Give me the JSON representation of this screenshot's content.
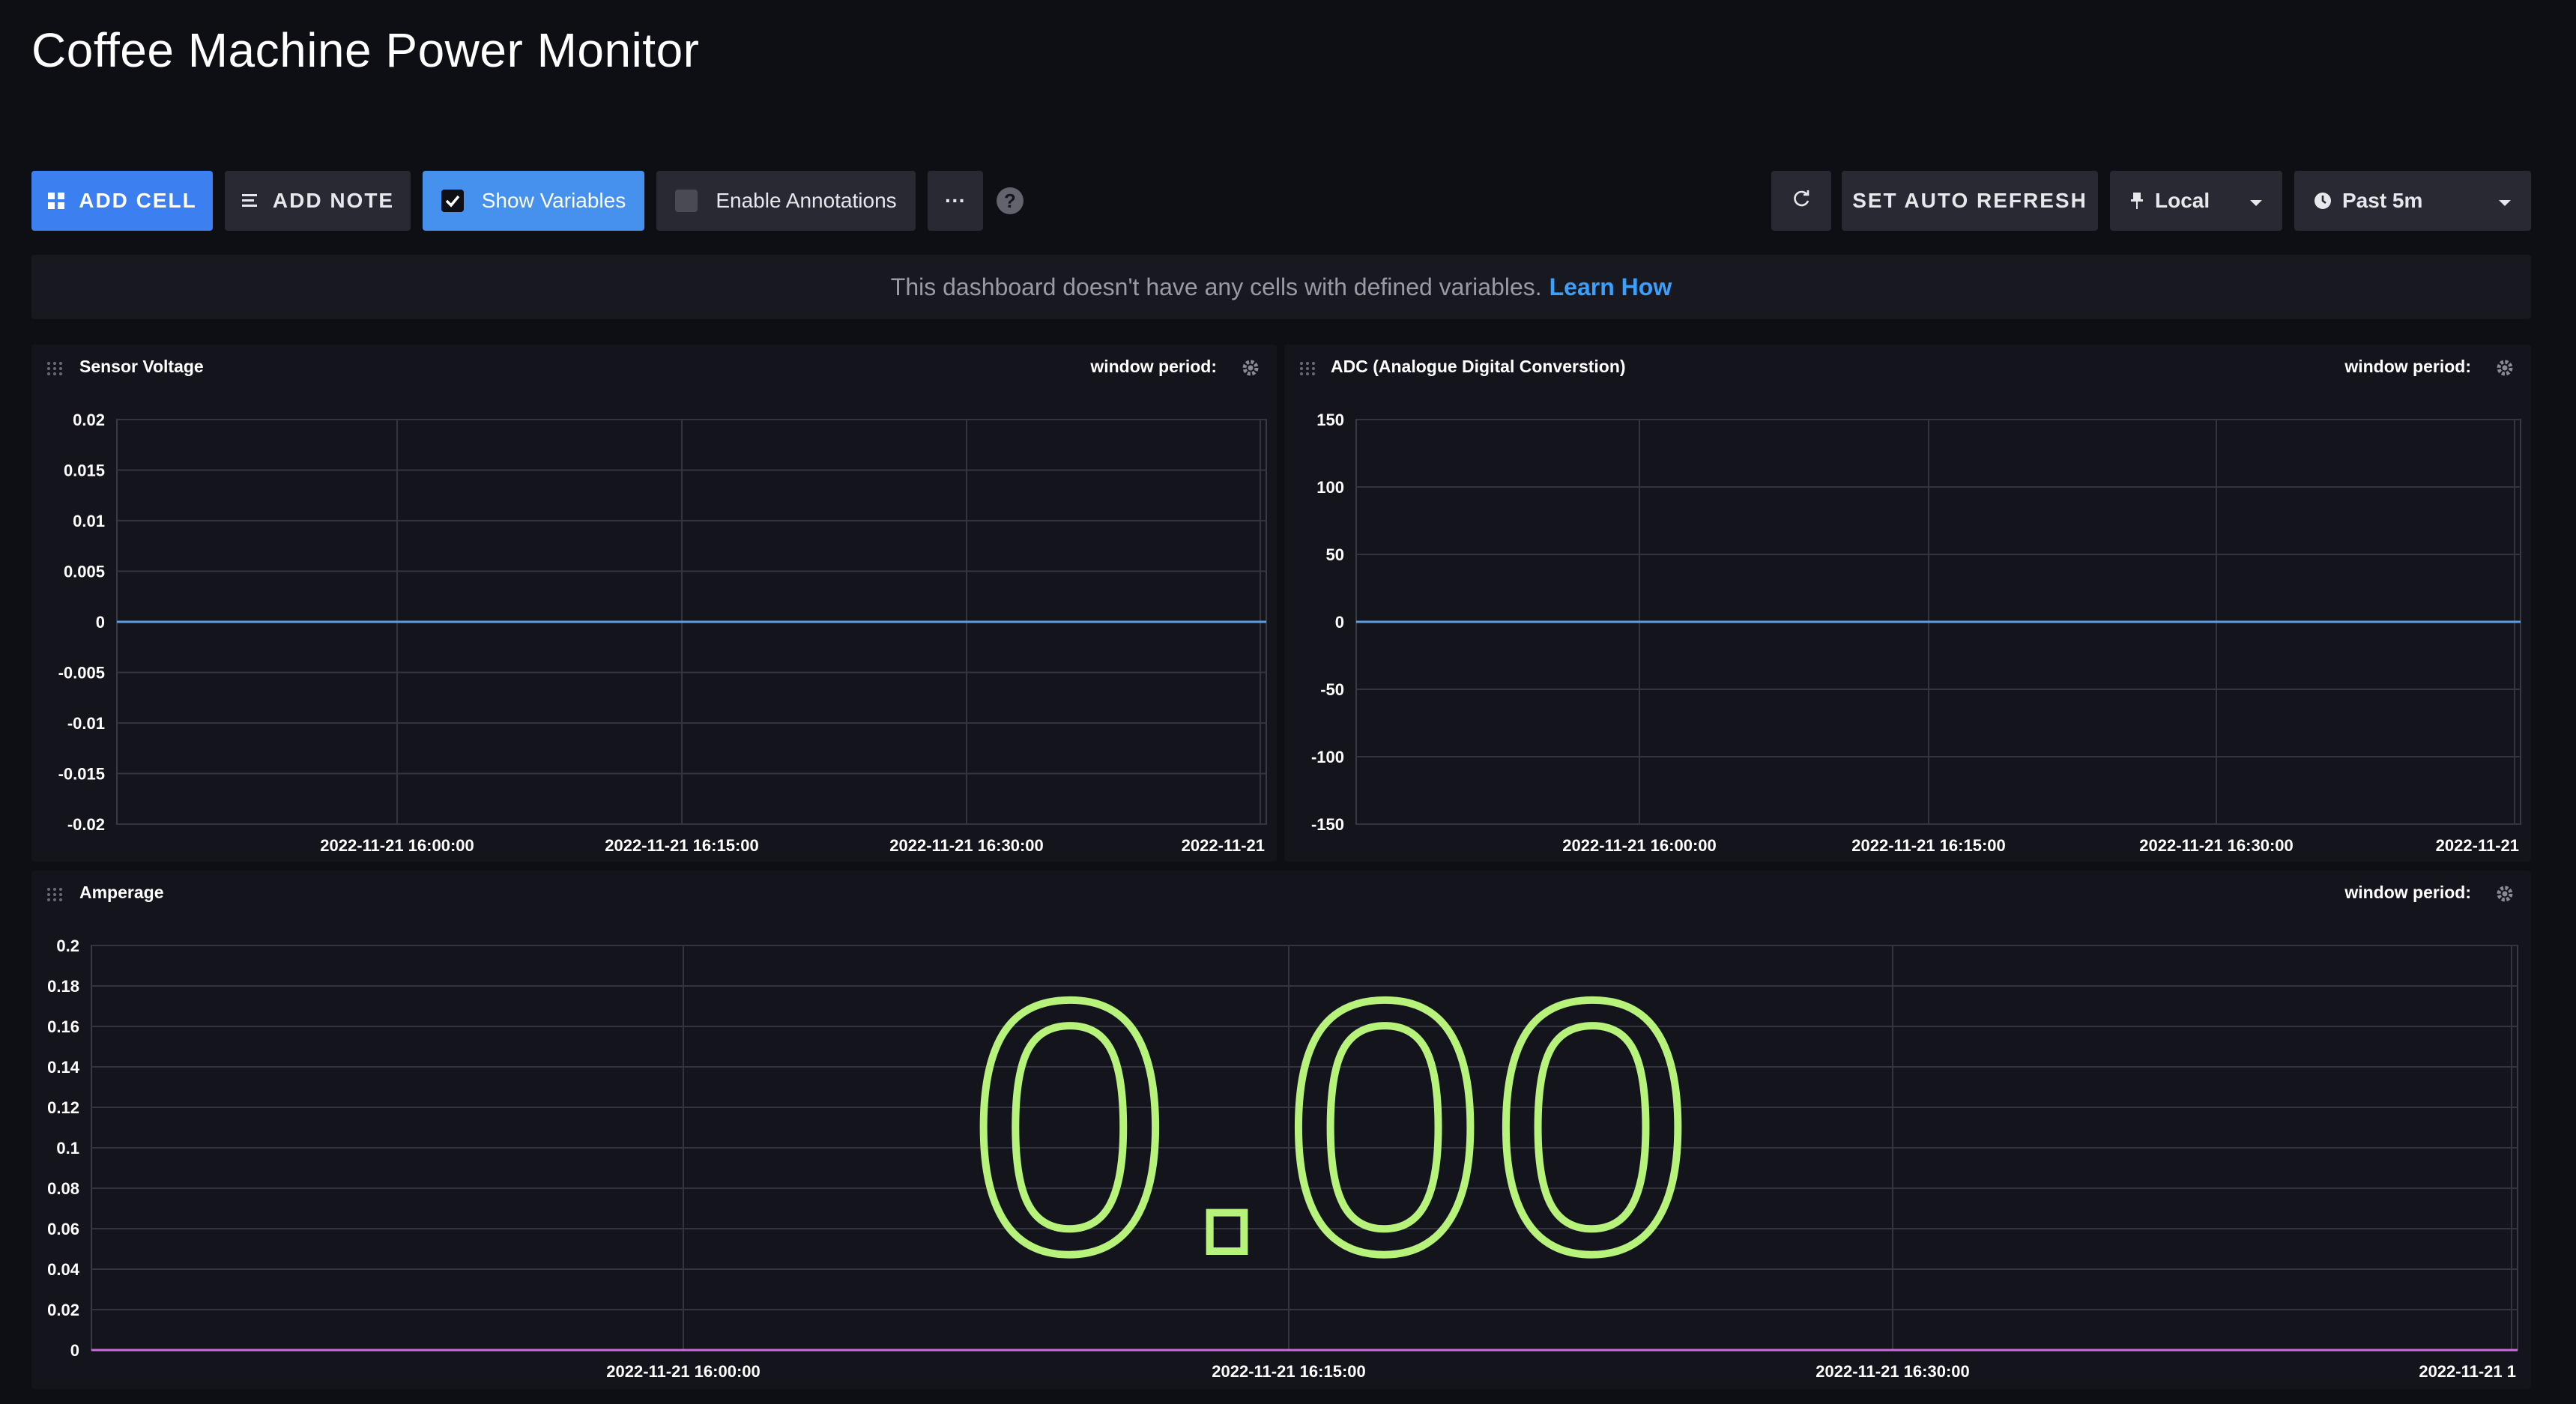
{
  "dashboard": {
    "title": "Coffee Machine Power Monitor"
  },
  "toolbar": {
    "add_cell": "ADD CELL",
    "add_note": "ADD NOTE",
    "show_variables": "Show Variables",
    "show_variables_checked": true,
    "enable_annotations": "Enable Annotations",
    "enable_annotations_checked": false,
    "more": "···",
    "help": "?",
    "auto_refresh": "SET AUTO REFRESH",
    "timezone": "Local",
    "time_range": "Past 5m"
  },
  "banner": {
    "text": "This dashboard doesn't have any cells with defined variables.",
    "link": "Learn How"
  },
  "cells": [
    {
      "title": "Sensor Voltage",
      "window_label": "window period:"
    },
    {
      "title": "ADC (Analogue Digital Converstion)",
      "window_label": "window period:"
    },
    {
      "title": "Amperage",
      "window_label": "window period:"
    }
  ],
  "colors": {
    "line_blue": "#5a9ee8",
    "single_stat": "#b7f27a",
    "line_purple": "#c86ed9",
    "accent": "#3b7ff1"
  },
  "chart_data": [
    {
      "type": "line",
      "title": "Sensor Voltage",
      "ylim": [
        -0.02,
        0.02
      ],
      "y_ticks": [
        "0.02",
        "0.015",
        "0.01",
        "0.005",
        "0",
        "-0.005",
        "-0.01",
        "-0.015",
        "-0.02"
      ],
      "x_ticks": [
        "2022-11-21 16:00:00",
        "2022-11-21 16:15:00",
        "2022-11-21 16:30:00",
        "2022-11-21"
      ],
      "series": [
        {
          "values": [
            0,
            0
          ]
        }
      ]
    },
    {
      "type": "line",
      "title": "ADC (Analogue Digital Converstion)",
      "ylim": [
        -150,
        150
      ],
      "y_ticks": [
        "150",
        "100",
        "50",
        "0",
        "-50",
        "-100",
        "-150"
      ],
      "x_ticks": [
        "2022-11-21 16:00:00",
        "2022-11-21 16:15:00",
        "2022-11-21 16:30:00",
        "2022-11-21"
      ],
      "series": [
        {
          "values": [
            0,
            0
          ]
        }
      ]
    },
    {
      "type": "line",
      "title": "Amperage",
      "ylim": [
        0,
        0.2
      ],
      "y_ticks": [
        "0.2",
        "0.18",
        "0.16",
        "0.14",
        "0.12",
        "0.1",
        "0.08",
        "0.06",
        "0.04",
        "0.02",
        "0"
      ],
      "x_ticks": [
        "2022-11-21 16:00:00",
        "2022-11-21 16:15:00",
        "2022-11-21 16:30:00",
        "2022-11-21 1"
      ],
      "series": [
        {
          "values": [
            0,
            0
          ]
        }
      ],
      "single_stat": "0.00"
    }
  ]
}
